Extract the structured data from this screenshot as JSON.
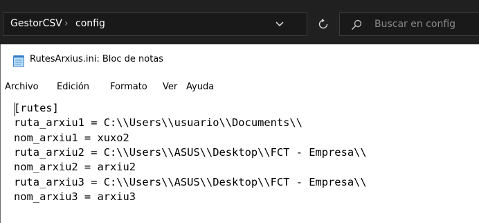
{
  "explorer": {
    "breadcrumb": {
      "root": "GestorCSV",
      "separator": "›",
      "current": "config"
    },
    "search": {
      "placeholder": "Buscar en config"
    }
  },
  "notepad": {
    "title": "RutesArxius.ini: Bloc de notas",
    "menu": [
      "Archivo",
      "Edición",
      "Formato",
      "Ver",
      "Ayuda"
    ],
    "lines": [
      "[rutes]",
      "ruta_arxiu1 = C:\\\\Users\\\\usuario\\\\Documents\\\\",
      "nom_arxiu1 = xuxo2",
      "ruta_arxiu2 = C:\\\\Users\\\\ASUS\\\\Desktop\\\\FCT - Empresa\\\\",
      "nom_arxiu2 = arxiu2",
      "ruta_arxiu3 = C:\\\\Users\\\\ASUS\\\\Desktop\\\\FCT - Empresa\\\\",
      "nom_arxiu3 = arxiu3"
    ]
  },
  "colors": {
    "explorer_bg": "#202020",
    "address_bg": "#191919",
    "editor_bg": "#ffffff"
  }
}
